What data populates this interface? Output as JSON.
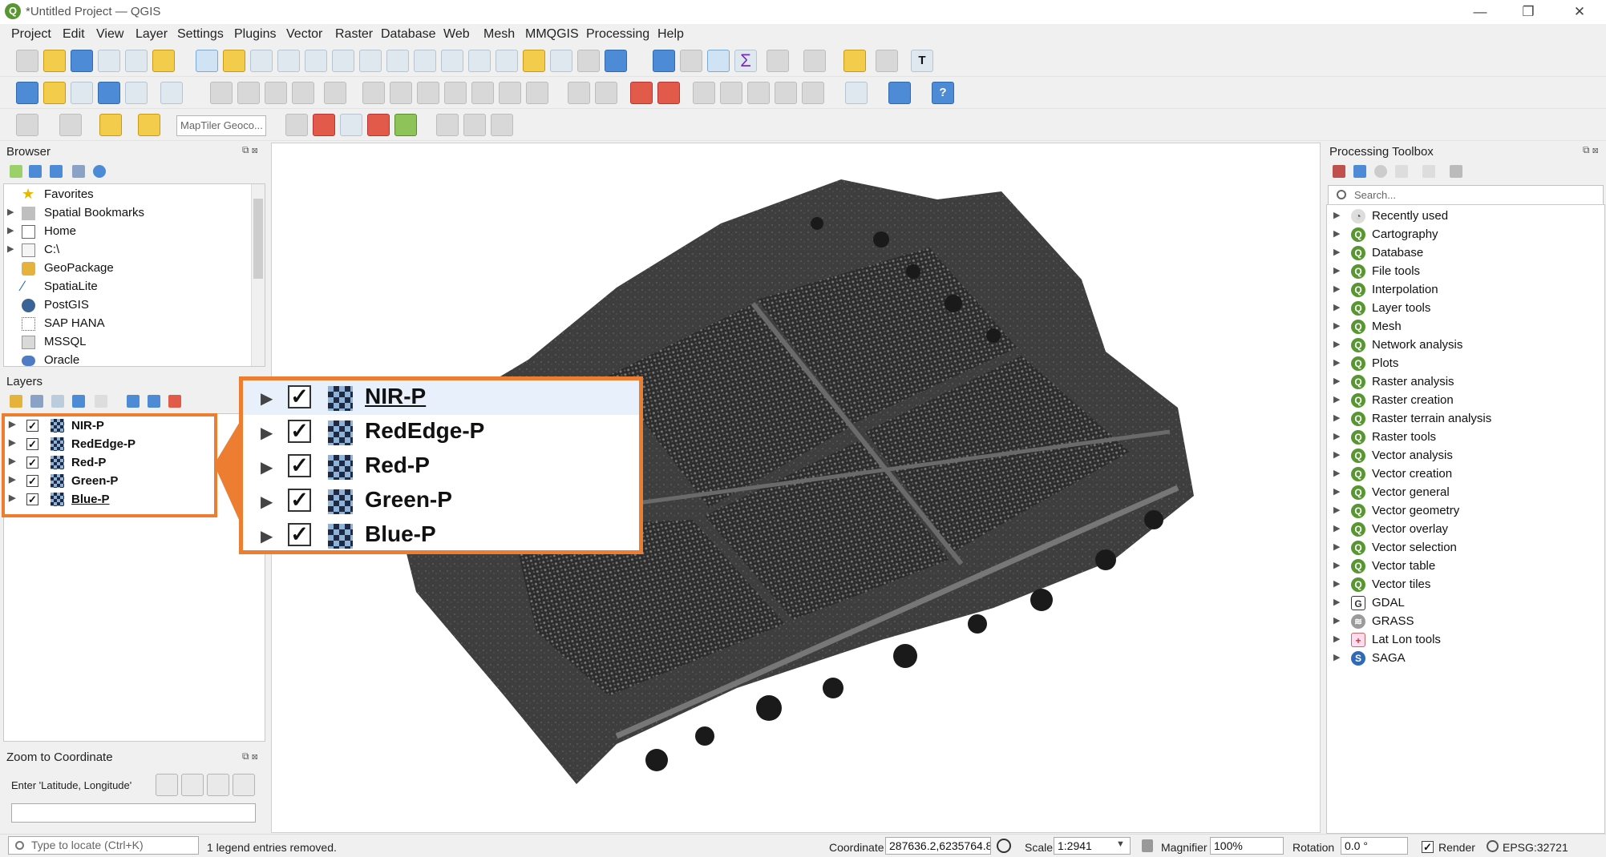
{
  "window": {
    "title": "*Untitled Project — QGIS",
    "minimize": "—",
    "maximize": "❐",
    "close": "✕"
  },
  "menubar": [
    "Project",
    "Edit",
    "View",
    "Layer",
    "Settings",
    "Plugins",
    "Vector",
    "Raster",
    "Database",
    "Web",
    "Mesh",
    "MMQGIS",
    "Processing",
    "Help"
  ],
  "toolbar": {
    "geocoder_placeholder": "MapTiler Geoco..."
  },
  "browser": {
    "title": "Browser",
    "items": [
      {
        "label": "Favorites",
        "icon": "star-icon",
        "expandable": false
      },
      {
        "label": "Spatial Bookmarks",
        "icon": "bookmark-icon",
        "expandable": true
      },
      {
        "label": "Home",
        "icon": "home-folder-icon",
        "expandable": true
      },
      {
        "label": "C:\\",
        "icon": "drive-icon",
        "expandable": true
      },
      {
        "label": "GeoPackage",
        "icon": "geopackage-icon",
        "expandable": false
      },
      {
        "label": "SpatiaLite",
        "icon": "spatialite-icon",
        "expandable": false
      },
      {
        "label": "PostGIS",
        "icon": "postgis-icon",
        "expandable": false
      },
      {
        "label": "SAP HANA",
        "icon": "sap-hana-icon",
        "expandable": false
      },
      {
        "label": "MSSQL",
        "icon": "mssql-icon",
        "expandable": false
      },
      {
        "label": "Oracle",
        "icon": "oracle-icon",
        "expandable": false
      }
    ]
  },
  "layers": {
    "title": "Layers",
    "items": [
      {
        "label": "NIR-P",
        "checked": "✓"
      },
      {
        "label": "RedEdge-P",
        "checked": "✓"
      },
      {
        "label": "Red-P",
        "checked": "✓"
      },
      {
        "label": "Green-P",
        "checked": "✓"
      },
      {
        "label": "Blue-P",
        "checked": "✓"
      }
    ],
    "zoomed_items": [
      {
        "label": "NIR-P",
        "checked": "✓"
      },
      {
        "label": "RedEdge-P",
        "checked": "✓"
      },
      {
        "label": "Red-P",
        "checked": "✓"
      },
      {
        "label": "Green-P",
        "checked": "✓"
      },
      {
        "label": "Blue-P",
        "checked": "✓"
      }
    ],
    "callout_color": "#ed7d31"
  },
  "zoom_to_coordinate": {
    "title": "Zoom to Coordinate",
    "label": "Enter 'Latitude, Longitude'",
    "value": ""
  },
  "processing": {
    "title": "Processing Toolbox",
    "search_placeholder": "Search...",
    "items": [
      {
        "label": "Recently used",
        "icon": "clock-icon"
      },
      {
        "label": "Cartography",
        "icon": "qgis-icon"
      },
      {
        "label": "Database",
        "icon": "qgis-icon"
      },
      {
        "label": "File tools",
        "icon": "qgis-icon"
      },
      {
        "label": "Interpolation",
        "icon": "qgis-icon"
      },
      {
        "label": "Layer tools",
        "icon": "qgis-icon"
      },
      {
        "label": "Mesh",
        "icon": "qgis-icon"
      },
      {
        "label": "Network analysis",
        "icon": "qgis-icon"
      },
      {
        "label": "Plots",
        "icon": "qgis-icon"
      },
      {
        "label": "Raster analysis",
        "icon": "qgis-icon"
      },
      {
        "label": "Raster creation",
        "icon": "qgis-icon"
      },
      {
        "label": "Raster terrain analysis",
        "icon": "qgis-icon"
      },
      {
        "label": "Raster tools",
        "icon": "qgis-icon"
      },
      {
        "label": "Vector analysis",
        "icon": "qgis-icon"
      },
      {
        "label": "Vector creation",
        "icon": "qgis-icon"
      },
      {
        "label": "Vector general",
        "icon": "qgis-icon"
      },
      {
        "label": "Vector geometry",
        "icon": "qgis-icon"
      },
      {
        "label": "Vector overlay",
        "icon": "qgis-icon"
      },
      {
        "label": "Vector selection",
        "icon": "qgis-icon"
      },
      {
        "label": "Vector table",
        "icon": "qgis-icon"
      },
      {
        "label": "Vector tiles",
        "icon": "qgis-icon"
      },
      {
        "label": "GDAL",
        "icon": "gdal-icon"
      },
      {
        "label": "GRASS",
        "icon": "grass-icon"
      },
      {
        "label": "Lat Lon tools",
        "icon": "latlon-icon"
      },
      {
        "label": "SAGA",
        "icon": "saga-icon"
      }
    ]
  },
  "statusbar": {
    "locator_placeholder": "Type to locate (Ctrl+K)",
    "message": "1 legend entries removed.",
    "coordinate_label": "Coordinate",
    "coordinate_value": "287636.2,6235764.8",
    "scale_label": "Scale",
    "scale_value": "1:2941",
    "magnifier_label": "Magnifier",
    "magnifier_value": "100%",
    "rotation_label": "Rotation",
    "rotation_value": "0.0 °",
    "render_label": "Render",
    "render_checked": "✓",
    "crs": "EPSG:32721"
  }
}
